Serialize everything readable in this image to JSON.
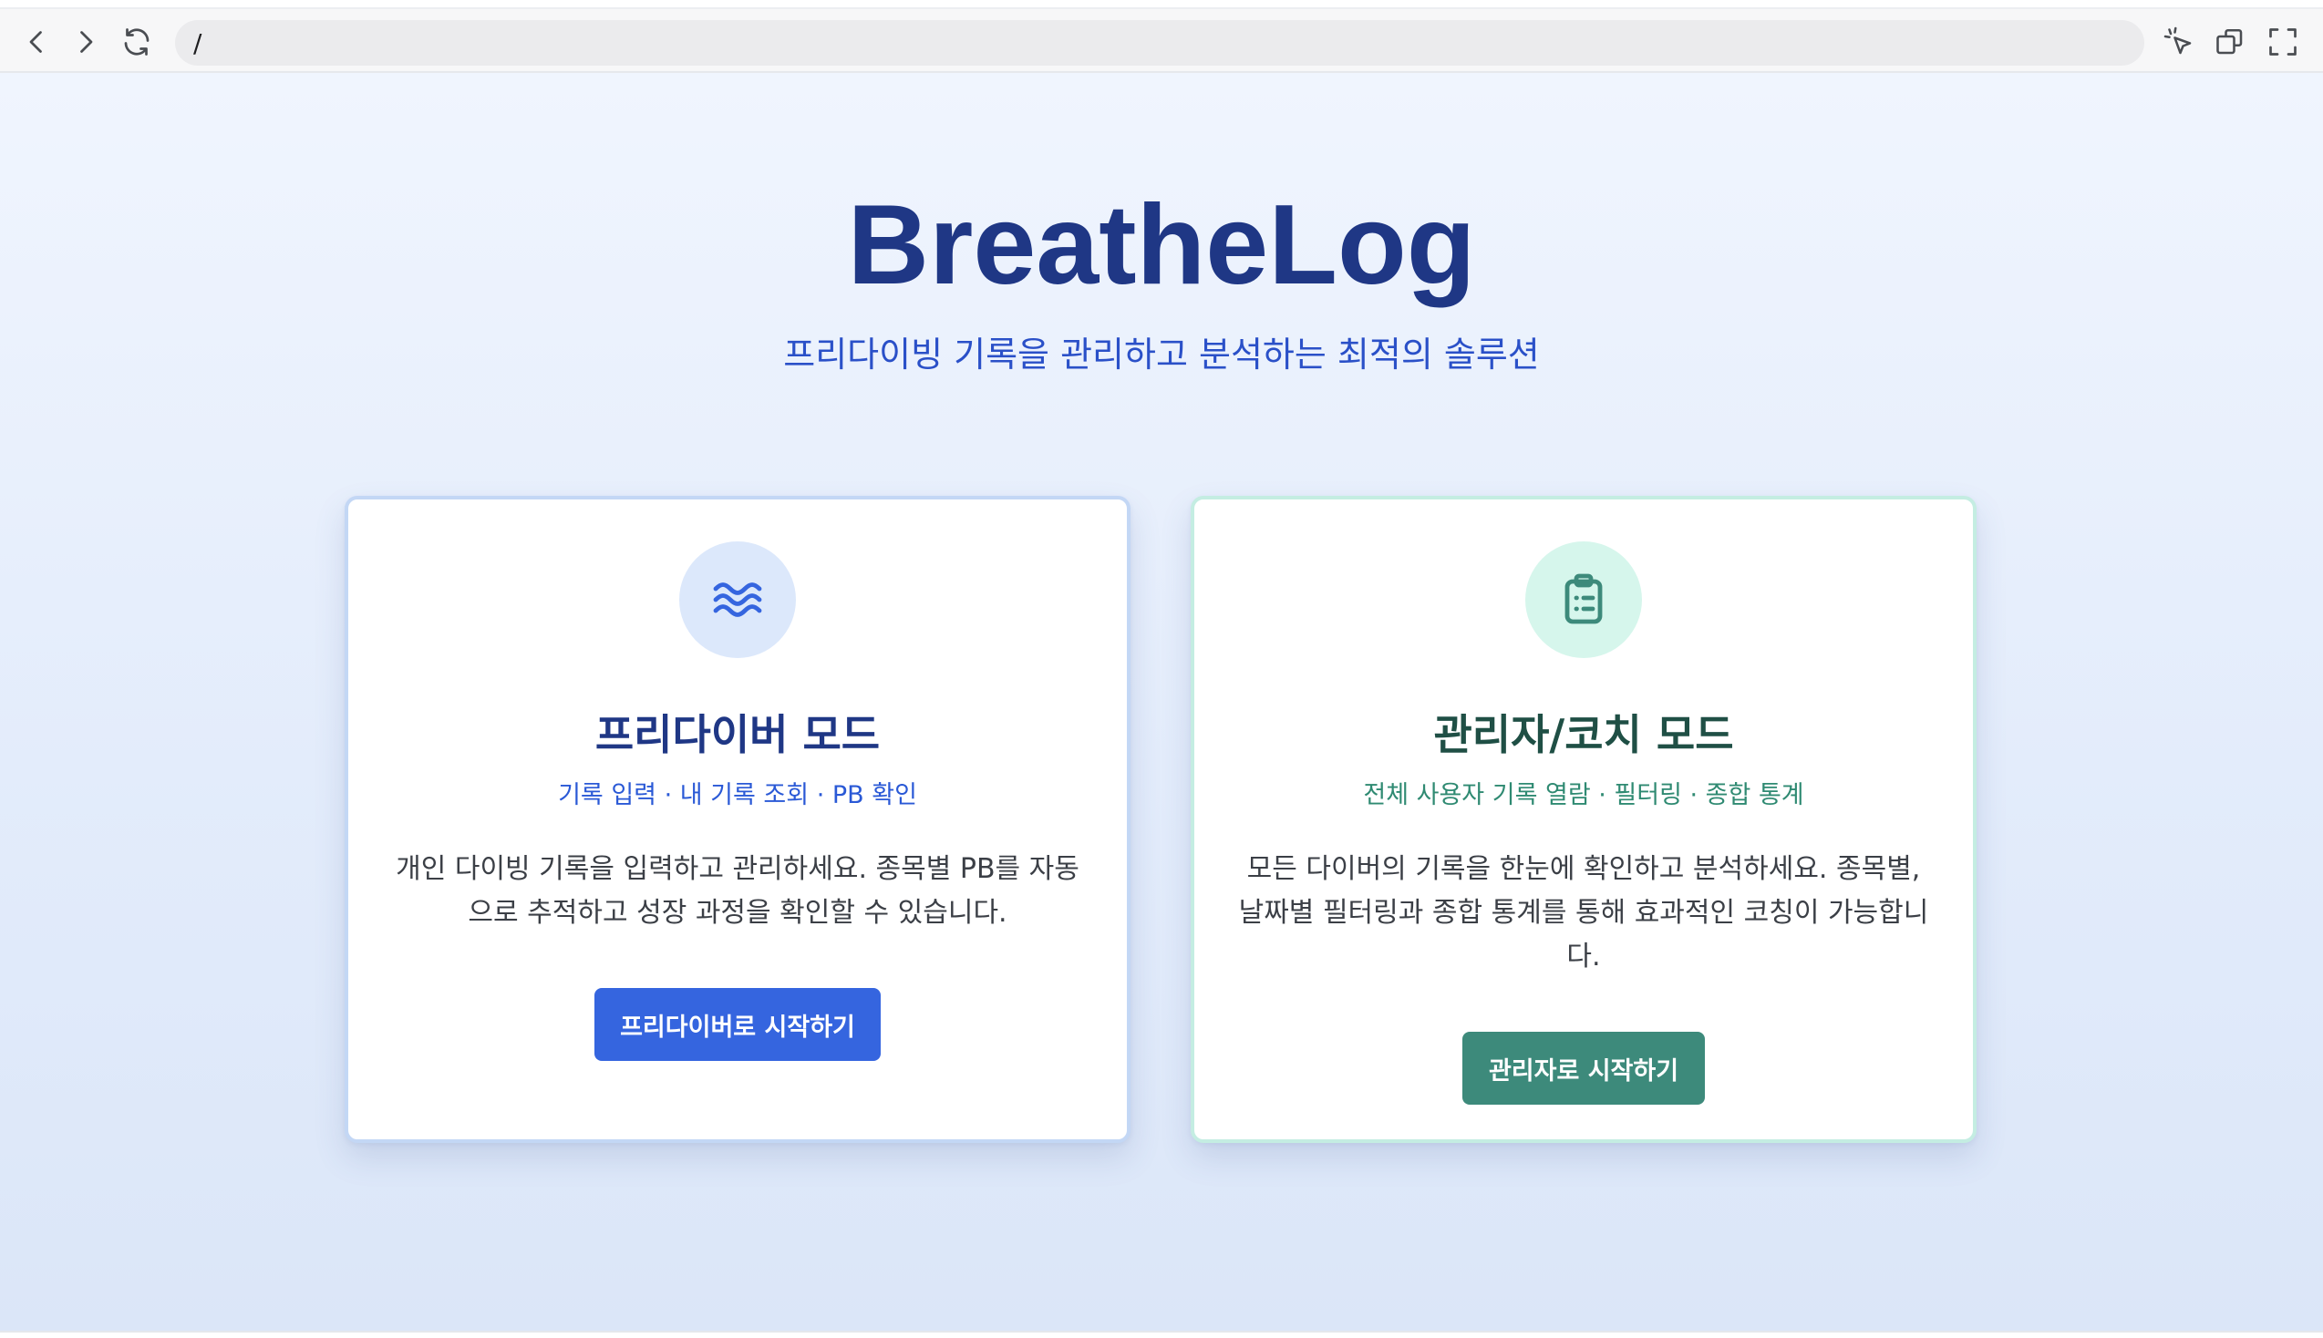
{
  "browser": {
    "address": "/",
    "icons": {
      "back": "chevron-left-icon",
      "forward": "chevron-right-icon",
      "reload": "reload-icon",
      "pointer": "cursor-click-icon",
      "window": "duplicate-window-icon",
      "fullscreen": "fullscreen-icon"
    }
  },
  "hero": {
    "title": "BreatheLog",
    "subtitle": "프리다이빙 기록을 관리하고 분석하는 최적의 솔루션"
  },
  "cards": {
    "diver": {
      "icon": "waves-icon",
      "title": "프리다이버 모드",
      "tagline": "기록 입력 · 내 기록 조회 · PB 확인",
      "description": "개인 다이빙 기록을 입력하고 관리하세요. 종목별 PB를 자동으로 추적하고 성장 과정을 확인할 수 있습니다.",
      "button": "프리다이버로 시작하기"
    },
    "admin": {
      "icon": "clipboard-list-icon",
      "title": "관리자/코치 모드",
      "tagline": "전체 사용자 기록 열람 · 필터링 · 종합 통계",
      "description": "모든 다이버의 기록을 한눈에 확인하고 분석하세요. 종목별, 날짜별 필터링과 종합 통계를 통해 효과적인 코칭이 가능합니다.",
      "button": "관리자로 시작하기"
    }
  },
  "colors": {
    "brand_navy": "#1f3785",
    "diver_accent": "#3565df",
    "admin_accent": "#3d8a7b"
  }
}
